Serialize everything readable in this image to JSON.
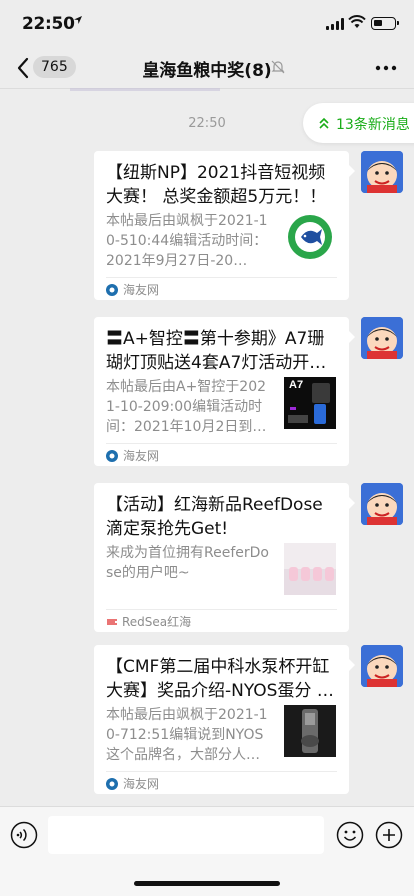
{
  "status_bar": {
    "time": "22:50"
  },
  "nav": {
    "unread_count": "765",
    "title": "皇海鱼粮中奖(8)"
  },
  "chat": {
    "time_label": "22:50",
    "new_messages": "13条新消息",
    "cards": [
      {
        "title": "【纽斯NP】2021抖音短视频大赛！ 总奖金额超5万元！！",
        "desc": "本帖最后由飒枫于2021-10-510:44编辑活动时间：2021年9月27日-20…",
        "source": "海友网",
        "thumb": "np-fish-logo"
      },
      {
        "title": "〓A+智控〓第十参期》A7珊瑚灯顶贴送4套A7灯活动开…",
        "desc": "本帖最后由A+智控于2021-10-209:00编辑活动时间：2021年10月2日到1…",
        "source": "海友网",
        "thumb": "a7-light-promo",
        "thumb_label": "A7"
      },
      {
        "title": "【活动】红海新品ReefDose滴定泵抢先Get!",
        "desc": "来成为首位拥有ReeferDose的用户吧~",
        "source": "RedSea红海",
        "thumb": "reefdose-product"
      },
      {
        "title": "【CMF第二届中科水泵杯开缸大赛】奖品介绍-NYOS蛋分 …",
        "desc": "本帖最后由飒枫于2021-10-712:51编辑说到NYOS这个品牌名，大部分人…",
        "source": "海友网",
        "thumb": "nyos-skimmer"
      }
    ]
  },
  "colors": {
    "background": "#ededed",
    "accent_green": "#1aad19",
    "card": "#ffffff",
    "muted_text": "#8d8d8d"
  }
}
